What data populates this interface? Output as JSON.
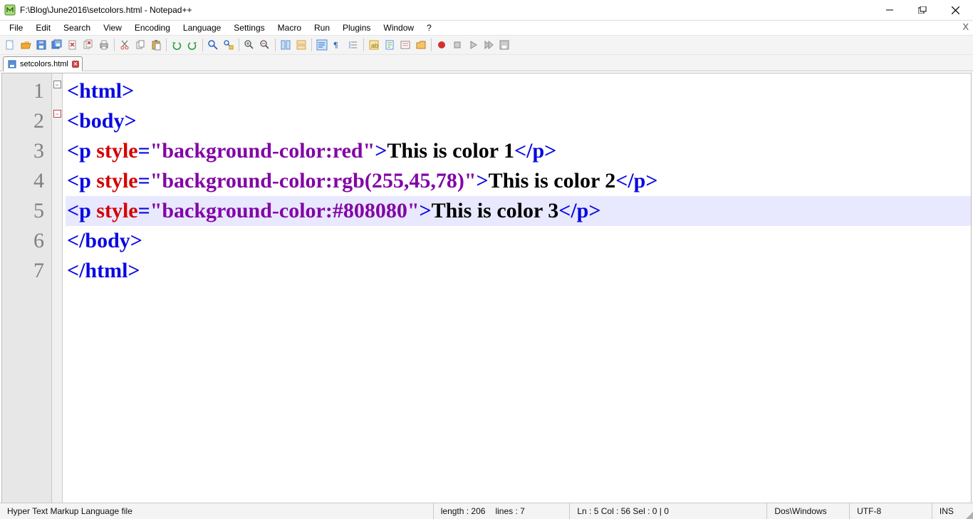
{
  "window": {
    "title": "F:\\Blog\\June2016\\setcolors.html - Notepad++"
  },
  "menu": [
    "File",
    "Edit",
    "Search",
    "View",
    "Encoding",
    "Language",
    "Settings",
    "Macro",
    "Run",
    "Plugins",
    "Window",
    "?"
  ],
  "toolbar_icons": [
    "new-file-icon",
    "open-file-icon",
    "save-icon",
    "save-all-icon",
    "close-icon",
    "close-all-icon",
    "print-icon",
    "sep",
    "cut-icon",
    "copy-icon",
    "paste-icon",
    "sep",
    "undo-icon",
    "redo-icon",
    "sep",
    "find-icon",
    "replace-icon",
    "sep",
    "zoom-in-icon",
    "zoom-out-icon",
    "sep",
    "sync-v-icon",
    "sync-h-icon",
    "sep",
    "wrap-icon",
    "show-chars-icon",
    "indent-guide-icon",
    "sep",
    "lang-icon",
    "doc-map-icon",
    "func-list-icon",
    "folder-icon",
    "sep",
    "record-macro-icon",
    "stop-macro-icon",
    "play-macro-icon",
    "play-multi-icon",
    "save-macro-icon"
  ],
  "tab": {
    "label": "setcolors.html"
  },
  "gutter": [
    "1",
    "2",
    "3",
    "4",
    "5",
    "6",
    "7"
  ],
  "code": {
    "l1_tag": "<html>",
    "l2_tag": "<body>",
    "l3_open": "<p ",
    "l3_attr": "style",
    "l3_eq": "=",
    "l3_val": "\"background-color:red\"",
    "l3_gt": ">",
    "l3_text": "This is color 1",
    "l3_close": "</p>",
    "l4_open": "<p ",
    "l4_attr": "style",
    "l4_eq": "=",
    "l4_val": "\"background-color:rgb(255,45,78)\"",
    "l4_gt": ">",
    "l4_text": "This is color 2",
    "l4_close": "</p>",
    "l5_open": "<p ",
    "l5_attr": "style",
    "l5_eq": "=",
    "l5_val": "\"background-color:#808080\"",
    "l5_gt": ">",
    "l5_text": "This is color 3",
    "l5_close": "</p>",
    "l6_tag": "</body>",
    "l7_tag": "</html>"
  },
  "status": {
    "filetype": "Hyper Text Markup Language file",
    "length": "length : 206",
    "lines": "lines : 7",
    "pos": "Ln : 5    Col : 56    Sel : 0 | 0",
    "eol": "Dos\\Windows",
    "encoding": "UTF-8",
    "mode": "INS"
  }
}
